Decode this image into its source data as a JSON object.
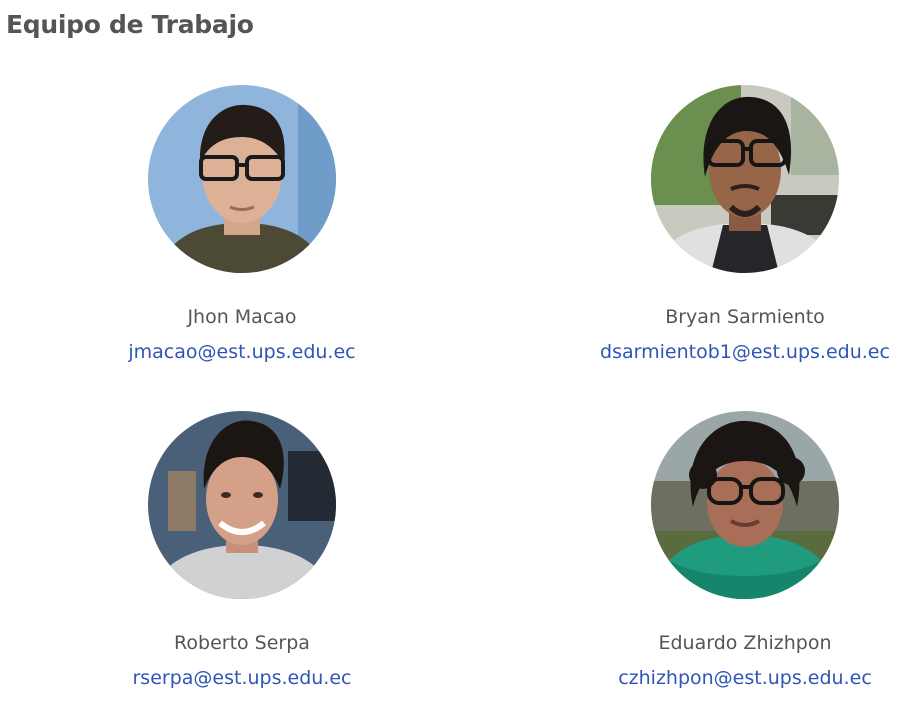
{
  "page": {
    "title": "Equipo de Trabajo"
  },
  "members": [
    {
      "name": "Jhon Macao",
      "email": "jmacao@est.ups.edu.ec",
      "photo_icon": "avatar-photo",
      "bg_color": "#8fb5dd"
    },
    {
      "name": "Bryan Sarmiento",
      "email": "dsarmientob1@est.ups.edu.ec",
      "photo_icon": "avatar-photo",
      "bg_color": "#7d9a6a"
    },
    {
      "name": "Roberto Serpa",
      "email": "rserpa@est.ups.edu.ec",
      "photo_icon": "avatar-photo",
      "bg_color": "#4a5f78"
    },
    {
      "name": "Eduardo Zhizhpon",
      "email": "czhizhpon@est.ups.edu.ec",
      "photo_icon": "avatar-photo",
      "bg_color": "#9aa6a8"
    }
  ],
  "colors": {
    "title": "#555555",
    "name": "#555555",
    "link": "#2f55b6"
  }
}
